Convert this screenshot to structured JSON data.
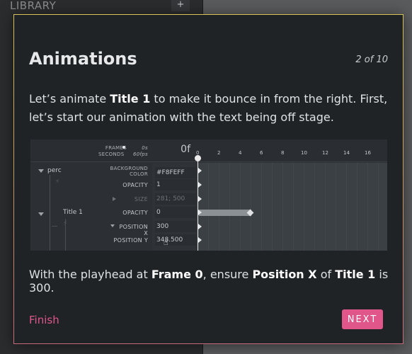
{
  "background": {
    "library_label": "LIBRARY",
    "add_label": "+"
  },
  "modal": {
    "title": "Animations",
    "counter": "2 of 10",
    "intro": {
      "t1": "Let’s animate ",
      "b1": "Title 1",
      "t2": " to make it bounce in from the right. First, let’s start our animation with the text being off stage."
    },
    "instruction": {
      "t1": "With the playhead at ",
      "b1": "Frame 0",
      "t2": ", ensure ",
      "b2": "Position X",
      "t3": " of ",
      "b3": "Title 1",
      "t4": " is 300."
    },
    "finish_label": "Finish",
    "next_label": "NEXT"
  },
  "timeline": {
    "frames_label": "FRAMES",
    "seconds_label": "SECONDS",
    "seconds_value": "0s",
    "fps_value": "60fps",
    "frame_readout": "0f",
    "ticks": [
      "0",
      "2",
      "4",
      "6",
      "8",
      "10",
      "12",
      "14",
      "16"
    ],
    "layers": [
      {
        "name": "perc"
      },
      {
        "name": "Title 1"
      }
    ],
    "properties": {
      "background_color_l1": "BACKGROUND",
      "background_color_l2": "COLOR",
      "background_color_value": "#F8FEFF",
      "opacity_label": "OPACITY",
      "opacity_value_perc": "1",
      "size_label": "SIZE",
      "size_value": "281; 500",
      "opacity_value_title": "0",
      "position_x_label": "POSITION X",
      "position_x_value": "300",
      "position_y_label": "POSITION Y",
      "position_y_value": "348.500"
    }
  }
}
